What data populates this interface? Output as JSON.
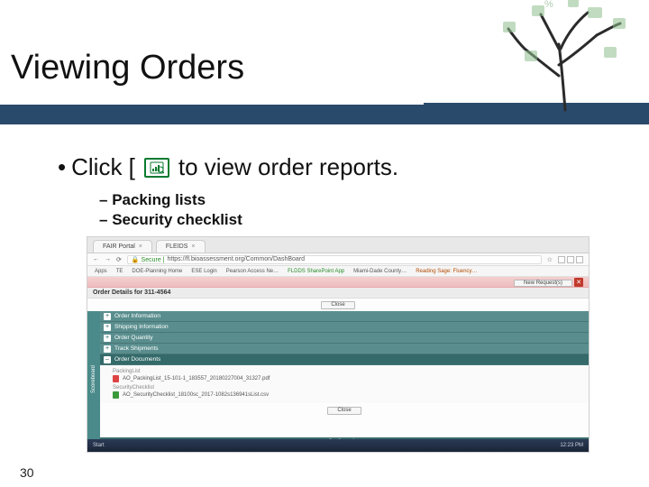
{
  "slide": {
    "title": "Viewing Orders",
    "page_number": "30"
  },
  "bullet": {
    "prefix": "Click [",
    "suffix": "to view order reports.",
    "icon_name": "report-icon"
  },
  "sub_bullets": [
    "Packing lists",
    "Security checklist"
  ],
  "browser": {
    "tabs": [
      {
        "label": "FAIR Portal"
      },
      {
        "label": "FLEIDS"
      }
    ],
    "back": "←",
    "forward": "→",
    "reload": "⟳",
    "secure_label": "Secure",
    "url": "https://fl.bioassessment.org/Common/DashBoard",
    "star": "☆",
    "bookmarks": [
      "Apps",
      "TE",
      "DOE-Planning Home",
      "ESE Login",
      "Pearson Access Ne…",
      "FLDDS SharePoint App",
      "Miami-Dade County…",
      "Reading Sage: Fluency…"
    ]
  },
  "app": {
    "banner_text": "",
    "user_button": "New Request(s)",
    "details_title": "Order Details for 311-4564",
    "close_btn": "Close",
    "vertical_tab": "Scoreboard",
    "accordion": [
      {
        "icon": "+",
        "label": "Order Information"
      },
      {
        "icon": "+",
        "label": "Shipping Information"
      },
      {
        "icon": "+",
        "label": "Order Quantity"
      },
      {
        "icon": "+",
        "label": "Track Shipments"
      },
      {
        "icon": "–",
        "label": "Order Documents",
        "expanded": true
      }
    ],
    "files": {
      "group1_label": "PackingList",
      "file1": "AO_PackingList_15-101-1_183557_20180227004_31327.pdf",
      "group2_label": "SecurityChecklist",
      "file2": "AO_SecurityChecklist_18100sc_2017-1082s136941sList.csv"
    },
    "bottom_close": "Close",
    "footer_label": "Configuration"
  },
  "taskbar": {
    "start": "Start",
    "time": "12:23 PM"
  }
}
